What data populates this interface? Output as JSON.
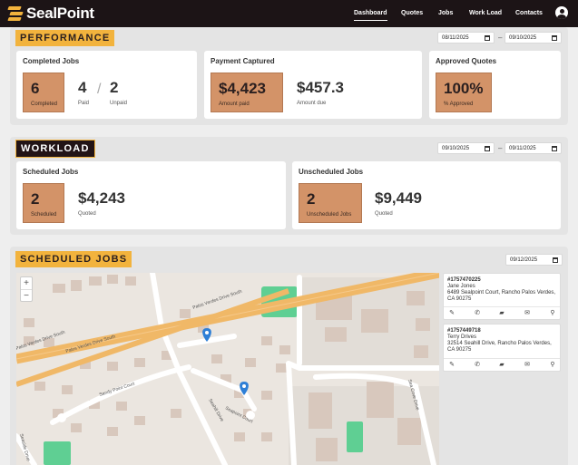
{
  "brand": {
    "name": "SealPoint"
  },
  "nav": {
    "items": [
      "Dashboard",
      "Quotes",
      "Jobs",
      "Work Load",
      "Contacts"
    ],
    "active": "Dashboard"
  },
  "performance": {
    "title": "PERFORMANCE",
    "date_from": "08/11/2025",
    "date_to": "09/10/2025",
    "completed": {
      "title": "Completed Jobs",
      "value": "6",
      "value_label": "Completed",
      "paid": "4",
      "paid_label": "Paid",
      "unpaid": "2",
      "unpaid_label": "Unpaid"
    },
    "payment": {
      "title": "Payment Captured",
      "amount_paid": "$4,423",
      "amount_paid_label": "Amount paid",
      "amount_due": "$457.3",
      "amount_due_label": "Amount due"
    },
    "quotes": {
      "title": "Approved Quotes",
      "value": "100%",
      "label": "% Approved"
    }
  },
  "workload": {
    "title": "WORKLOAD",
    "date_from": "09/10/2025",
    "date_to": "09/11/2025",
    "scheduled": {
      "title": "Scheduled Jobs",
      "count": "2",
      "count_label": "Scheduled",
      "quoted": "$4,243",
      "quoted_label": "Quoted"
    },
    "unscheduled": {
      "title": "Unscheduled Jobs",
      "count": "2",
      "count_label": "Unscheduled Jobs",
      "quoted": "$9,449",
      "quoted_label": "Quoted"
    }
  },
  "scheduled_jobs": {
    "title": "SCHEDULED JOBS",
    "date": "09/12/2025",
    "map": {
      "zoom_in": "+",
      "zoom_out": "−",
      "street_labels": [
        "Palos Verdes Drive South",
        "Palos Verdes Drive South",
        "Palos Verdes Drive South",
        "Sandy Point Court",
        "Seahill Drive",
        "Seapoint Court",
        "Sea Cove Drive",
        "Seaside Drive"
      ]
    },
    "jobs": [
      {
        "number": "#1757470225",
        "name": "Jane Jones",
        "address1": "6489 Sealpoint Court, Rancho Palos Verdes,",
        "address2": "CA 90275"
      },
      {
        "number": "#1757449718",
        "name": "Terry Drives",
        "address1": "32514 Seahill Drive, Rancho Palos Verdes,",
        "address2": "CA 90275"
      }
    ]
  },
  "icons": [
    "pencil-icon",
    "phone-icon",
    "message-icon",
    "mail-icon",
    "location-icon",
    "calendar-icon",
    "user-icon"
  ],
  "colors": {
    "accent": "#f2b33d",
    "tile": "#d39368",
    "dark": "#1c1416",
    "road": "#f0b867",
    "green": "#5fcf93",
    "pin": "#2e7fd6"
  }
}
